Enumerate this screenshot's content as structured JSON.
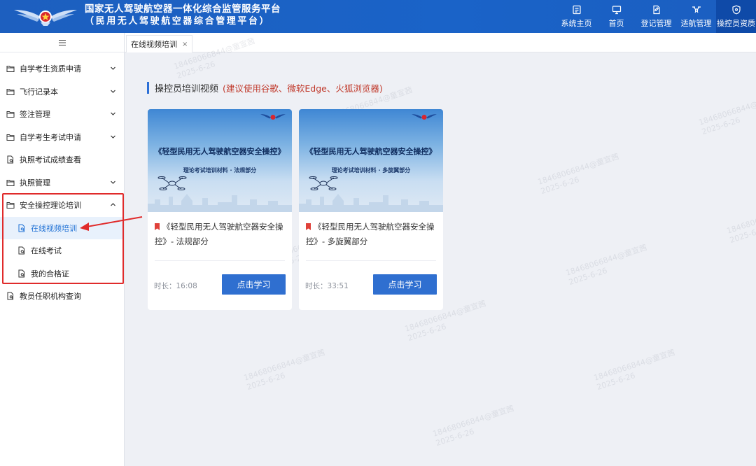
{
  "header": {
    "title_line1": "国家无人驾驶航空器一体化综合监管服务平台",
    "title_line2": "（民用无人驾驶航空器综合管理平台）",
    "nav": [
      {
        "label": "系统主页",
        "icon": "dashboard-icon"
      },
      {
        "label": "首页",
        "icon": "monitor-icon"
      },
      {
        "label": "登记管理",
        "icon": "document-edit-icon"
      },
      {
        "label": "适航管理",
        "icon": "drone-icon"
      },
      {
        "label": "操控员资质",
        "icon": "shield-icon",
        "active": true
      }
    ]
  },
  "sidebar": {
    "toggle_icon": "hamburger-icon",
    "items": [
      {
        "label": "自学考生资质申请",
        "icon": "folder-icon",
        "expandable": true
      },
      {
        "label": "飞行记录本",
        "icon": "folder-icon",
        "expandable": true
      },
      {
        "label": "签注管理",
        "icon": "folder-icon",
        "expandable": true
      },
      {
        "label": "自学考生考试申请",
        "icon": "folder-icon",
        "expandable": true
      },
      {
        "label": "执照考试成绩查看",
        "icon": "file-search-icon",
        "expandable": false
      },
      {
        "label": "执照管理",
        "icon": "folder-icon",
        "expandable": true
      },
      {
        "label": "安全操控理论培训",
        "icon": "folder-icon",
        "expandable": true,
        "expanded": true,
        "children": [
          {
            "label": "在线视频培训",
            "icon": "file-search-icon",
            "active": true
          },
          {
            "label": "在线考试",
            "icon": "file-search-icon"
          },
          {
            "label": "我的合格证",
            "icon": "file-search-icon"
          }
        ]
      },
      {
        "label": "教员任职机构查询",
        "icon": "file-search-icon",
        "expandable": false
      }
    ]
  },
  "tabs": [
    {
      "label": "在线视频培训",
      "close": "×"
    }
  ],
  "section": {
    "title": "操控员培训视频",
    "note": "(建议使用谷歌、微软Edge、火狐浏览器)"
  },
  "cards": [
    {
      "thumb_title": "《轻型民用无人驾驶航空器安全操控》",
      "thumb_subtitle": "理论考试培训材料 · 法规部分",
      "title": "《轻型民用无人驾驶航空器安全操控》- 法规部分",
      "duration_label": "时长：",
      "duration": "16:08",
      "button": "点击学习"
    },
    {
      "thumb_title": "《轻型民用无人驾驶航空器安全操控》",
      "thumb_subtitle": "理论考试培训材料 · 多旋翼部分",
      "title": "《轻型民用无人驾驶航空器安全操控》- 多旋翼部分",
      "duration_label": "时长：",
      "duration": "33:51",
      "button": "点击学习"
    }
  ],
  "watermark": {
    "line1": "18468066844@童宣茜",
    "line2": "2025-6-26"
  },
  "colors": {
    "header_bg": "#1a63c8",
    "accent": "#2f6fd0",
    "note_red": "#c0392b",
    "highlight_red": "#e02b2b"
  }
}
